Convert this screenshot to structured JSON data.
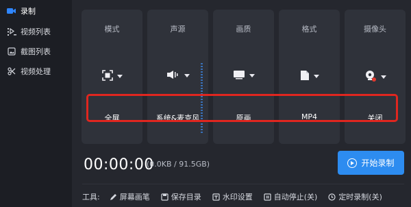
{
  "sidebar": {
    "items": [
      {
        "label": "录制",
        "icon": "camera-icon",
        "active": true
      },
      {
        "label": "视频列表",
        "icon": "video-list-icon"
      },
      {
        "label": "截图列表",
        "icon": "screenshot-list-icon"
      },
      {
        "label": "视频处理",
        "icon": "video-process-icon"
      }
    ]
  },
  "cards": [
    {
      "title": "模式",
      "value": "全屏",
      "icon": "fullscreen-icon"
    },
    {
      "title": "声源",
      "value": "系统&麦克风",
      "icon": "speaker-icon"
    },
    {
      "title": "画质",
      "value": "原画",
      "icon": "monitor-icon"
    },
    {
      "title": "格式",
      "value": "MP4",
      "icon": "file-icon"
    },
    {
      "title": "摄像头",
      "value": "关闭",
      "icon": "webcam-icon"
    }
  ],
  "status": {
    "timer": "00:00:00",
    "size": "(0.0KB / 91.5GB)"
  },
  "record_button": {
    "label": "开始录制"
  },
  "tools": {
    "label": "工具:",
    "items": [
      {
        "label": "屏幕画笔",
        "icon": "pen-icon"
      },
      {
        "label": "保存目录",
        "icon": "save-icon"
      },
      {
        "label": "水印设置",
        "icon": "watermark-icon"
      },
      {
        "label": "自动停止(关)",
        "icon": "auto-stop-icon"
      },
      {
        "label": "定时录制(关)",
        "icon": "schedule-icon"
      }
    ]
  },
  "colors": {
    "accent": "#2d8cf0",
    "highlight": "#e0261f",
    "background": "#24262d",
    "card": "#2f323a"
  }
}
